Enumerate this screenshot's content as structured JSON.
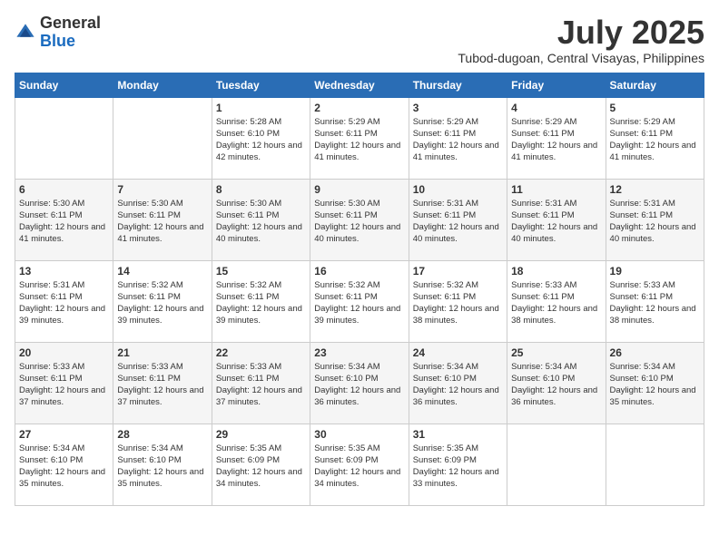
{
  "logo": {
    "general": "General",
    "blue": "Blue"
  },
  "title": "July 2025",
  "location": "Tubod-dugoan, Central Visayas, Philippines",
  "days_of_week": [
    "Sunday",
    "Monday",
    "Tuesday",
    "Wednesday",
    "Thursday",
    "Friday",
    "Saturday"
  ],
  "weeks": [
    [
      {
        "day": "",
        "info": ""
      },
      {
        "day": "",
        "info": ""
      },
      {
        "day": "1",
        "info": "Sunrise: 5:28 AM\nSunset: 6:10 PM\nDaylight: 12 hours and 42 minutes."
      },
      {
        "day": "2",
        "info": "Sunrise: 5:29 AM\nSunset: 6:11 PM\nDaylight: 12 hours and 41 minutes."
      },
      {
        "day": "3",
        "info": "Sunrise: 5:29 AM\nSunset: 6:11 PM\nDaylight: 12 hours and 41 minutes."
      },
      {
        "day": "4",
        "info": "Sunrise: 5:29 AM\nSunset: 6:11 PM\nDaylight: 12 hours and 41 minutes."
      },
      {
        "day": "5",
        "info": "Sunrise: 5:29 AM\nSunset: 6:11 PM\nDaylight: 12 hours and 41 minutes."
      }
    ],
    [
      {
        "day": "6",
        "info": "Sunrise: 5:30 AM\nSunset: 6:11 PM\nDaylight: 12 hours and 41 minutes."
      },
      {
        "day": "7",
        "info": "Sunrise: 5:30 AM\nSunset: 6:11 PM\nDaylight: 12 hours and 41 minutes."
      },
      {
        "day": "8",
        "info": "Sunrise: 5:30 AM\nSunset: 6:11 PM\nDaylight: 12 hours and 40 minutes."
      },
      {
        "day": "9",
        "info": "Sunrise: 5:30 AM\nSunset: 6:11 PM\nDaylight: 12 hours and 40 minutes."
      },
      {
        "day": "10",
        "info": "Sunrise: 5:31 AM\nSunset: 6:11 PM\nDaylight: 12 hours and 40 minutes."
      },
      {
        "day": "11",
        "info": "Sunrise: 5:31 AM\nSunset: 6:11 PM\nDaylight: 12 hours and 40 minutes."
      },
      {
        "day": "12",
        "info": "Sunrise: 5:31 AM\nSunset: 6:11 PM\nDaylight: 12 hours and 40 minutes."
      }
    ],
    [
      {
        "day": "13",
        "info": "Sunrise: 5:31 AM\nSunset: 6:11 PM\nDaylight: 12 hours and 39 minutes."
      },
      {
        "day": "14",
        "info": "Sunrise: 5:32 AM\nSunset: 6:11 PM\nDaylight: 12 hours and 39 minutes."
      },
      {
        "day": "15",
        "info": "Sunrise: 5:32 AM\nSunset: 6:11 PM\nDaylight: 12 hours and 39 minutes."
      },
      {
        "day": "16",
        "info": "Sunrise: 5:32 AM\nSunset: 6:11 PM\nDaylight: 12 hours and 39 minutes."
      },
      {
        "day": "17",
        "info": "Sunrise: 5:32 AM\nSunset: 6:11 PM\nDaylight: 12 hours and 38 minutes."
      },
      {
        "day": "18",
        "info": "Sunrise: 5:33 AM\nSunset: 6:11 PM\nDaylight: 12 hours and 38 minutes."
      },
      {
        "day": "19",
        "info": "Sunrise: 5:33 AM\nSunset: 6:11 PM\nDaylight: 12 hours and 38 minutes."
      }
    ],
    [
      {
        "day": "20",
        "info": "Sunrise: 5:33 AM\nSunset: 6:11 PM\nDaylight: 12 hours and 37 minutes."
      },
      {
        "day": "21",
        "info": "Sunrise: 5:33 AM\nSunset: 6:11 PM\nDaylight: 12 hours and 37 minutes."
      },
      {
        "day": "22",
        "info": "Sunrise: 5:33 AM\nSunset: 6:11 PM\nDaylight: 12 hours and 37 minutes."
      },
      {
        "day": "23",
        "info": "Sunrise: 5:34 AM\nSunset: 6:10 PM\nDaylight: 12 hours and 36 minutes."
      },
      {
        "day": "24",
        "info": "Sunrise: 5:34 AM\nSunset: 6:10 PM\nDaylight: 12 hours and 36 minutes."
      },
      {
        "day": "25",
        "info": "Sunrise: 5:34 AM\nSunset: 6:10 PM\nDaylight: 12 hours and 36 minutes."
      },
      {
        "day": "26",
        "info": "Sunrise: 5:34 AM\nSunset: 6:10 PM\nDaylight: 12 hours and 35 minutes."
      }
    ],
    [
      {
        "day": "27",
        "info": "Sunrise: 5:34 AM\nSunset: 6:10 PM\nDaylight: 12 hours and 35 minutes."
      },
      {
        "day": "28",
        "info": "Sunrise: 5:34 AM\nSunset: 6:10 PM\nDaylight: 12 hours and 35 minutes."
      },
      {
        "day": "29",
        "info": "Sunrise: 5:35 AM\nSunset: 6:09 PM\nDaylight: 12 hours and 34 minutes."
      },
      {
        "day": "30",
        "info": "Sunrise: 5:35 AM\nSunset: 6:09 PM\nDaylight: 12 hours and 34 minutes."
      },
      {
        "day": "31",
        "info": "Sunrise: 5:35 AM\nSunset: 6:09 PM\nDaylight: 12 hours and 33 minutes."
      },
      {
        "day": "",
        "info": ""
      },
      {
        "day": "",
        "info": ""
      }
    ]
  ]
}
